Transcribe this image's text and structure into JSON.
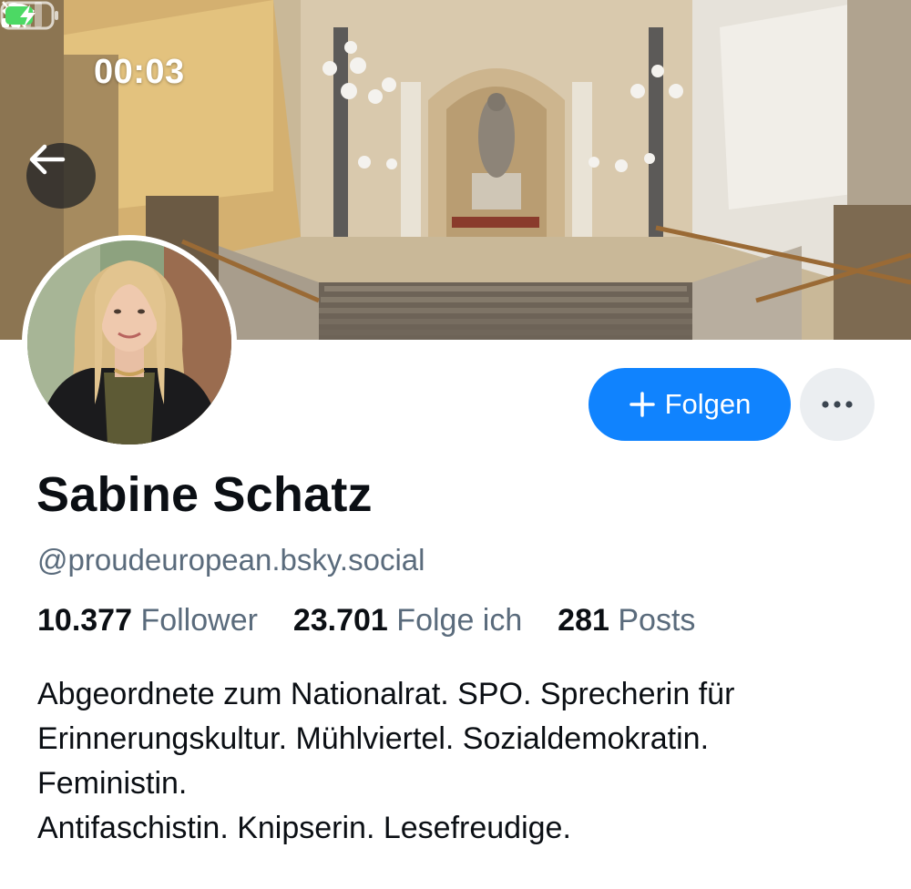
{
  "status_bar": {
    "time": "00:03",
    "icons": [
      "bell-slash-icon",
      "cellular-signal-icon",
      "wifi-icon",
      "battery-charging-icon"
    ]
  },
  "navigation": {
    "back_icon": "arrow-left-icon"
  },
  "profile": {
    "display_name": "Sabine Schatz",
    "handle": "@proudeuropean.bsky.social",
    "stats": [
      {
        "value": "10.377",
        "label": "Follower"
      },
      {
        "value": "23.701",
        "label": "Folge ich"
      },
      {
        "value": "281",
        "label": "Posts"
      }
    ],
    "bio_lines": [
      "Abgeordnete zum Nationalrat. SPO. Sprecherin für",
      "Erinnerungskultur. Mühlviertel. Sozialdemokratin.",
      "Feministin.",
      "Antifaschistin. Knipserin. Lesefreudige."
    ]
  },
  "actions": {
    "follow_label": "Folgen",
    "follow_icon": "plus-icon",
    "more_icon": "ellipsis-icon"
  },
  "colors": {
    "accent": "#1083fe",
    "muted_text": "#5a6b7c",
    "primary_text": "#0b0f14",
    "more_button_bg": "#ebeef1",
    "battery_green": "#4cd964"
  }
}
